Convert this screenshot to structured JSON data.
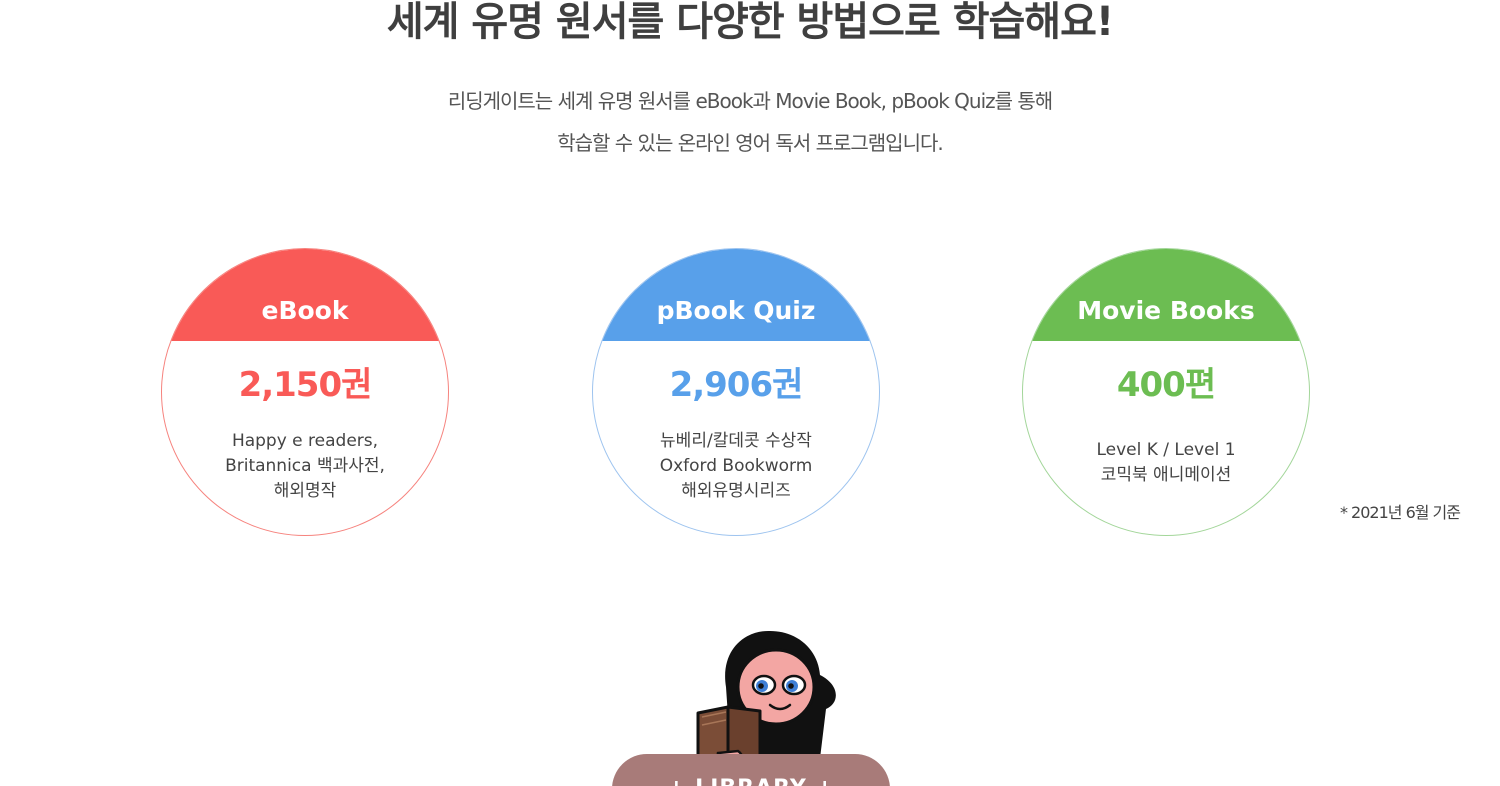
{
  "headline": "세계 유명 원서를 다양한 방법으로 학습해요!",
  "intro": {
    "line1": "리딩게이트는 세계 유명 원서를 eBook과 Movie Book, pBook Quiz를 통해",
    "line2": "학습할 수 있는 온라인 영어 독서 프로그램입니다."
  },
  "cards": [
    {
      "title": "eBook",
      "count": "2,150권",
      "lines": [
        "Happy e readers,",
        "Britannica 백과사전,",
        "해외명작"
      ],
      "color": "#f95a57"
    },
    {
      "title": "pBook Quiz",
      "count": "2,906권",
      "lines": [
        "뉴베리/칼데콧 수상작",
        "Oxford Bookworm",
        "해외유명시리즈"
      ],
      "color": "#58a0ea"
    },
    {
      "title": "Movie Books",
      "count": "400편",
      "lines": [
        "Level K / Level 1",
        "코믹북 애니메이션"
      ],
      "color": "#6cbd52"
    }
  ],
  "note": "* 2021년 6월 기준",
  "library_button": "+ LIBRARY +",
  "icons": {
    "mascot": "reading-character-icon"
  }
}
